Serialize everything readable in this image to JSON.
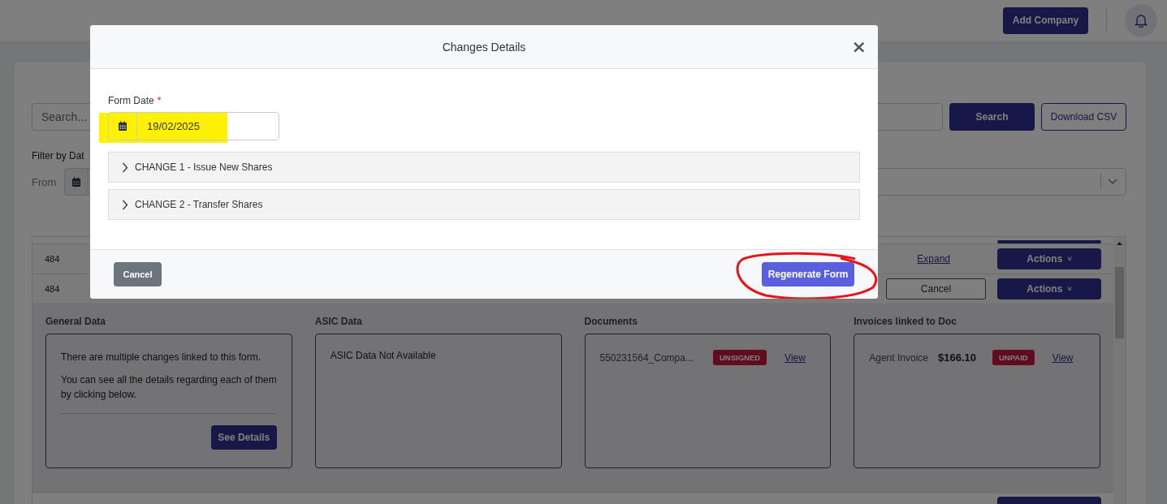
{
  "header": {
    "add_button": "Add Company"
  },
  "toolbar": {
    "search": {
      "placeholder": "Search..."
    },
    "search_button": "Search",
    "csv_button": "Download CSV"
  },
  "filter": {
    "label": "Filter by Dat",
    "from_label": "From"
  },
  "table": {
    "rows": [
      {
        "cell_1": "484",
        "link": "Expand",
        "action": "Actions",
        "caret": "˅"
      },
      {
        "cell_1": "484",
        "cancel": "Cancel",
        "action": "Actions",
        "caret": "˅"
      }
    ],
    "expanded": {
      "general": {
        "title": "General Data",
        "paragraphs": [
          "There are multiple changes linked to this form.",
          "You can see all the details regarding each of them by clicking below."
        ],
        "button": "See Details"
      },
      "asic": {
        "title": "ASIC Data",
        "text": "ASIC Data Not Available"
      },
      "documents": {
        "title": "Documents",
        "items": [
          {
            "name": "550231564_Compa...",
            "status": "UNSIGNED",
            "link": "View"
          }
        ]
      },
      "invoices": {
        "title": "Invoices linked to Doc",
        "items": [
          {
            "name": "Agent Invoice",
            "amount": "$166.10",
            "status": "UNPAID",
            "link": "View"
          }
        ]
      }
    }
  },
  "modal": {
    "title": "Changes Details",
    "close": "×",
    "form_date": {
      "label": "Form Date",
      "required_mark": "*",
      "value": "19/02/2025"
    },
    "accordion": [
      {
        "label": "CHANGE 1 - Issue New Shares",
        "expanded": false
      },
      {
        "label": "CHANGE 2 - Transfer Shares",
        "expanded": false
      }
    ],
    "cancel_button": "Cancel",
    "submit_button": "Regenerate Form"
  },
  "annotations": {
    "date_highlight": true,
    "button_circle": true
  }
}
